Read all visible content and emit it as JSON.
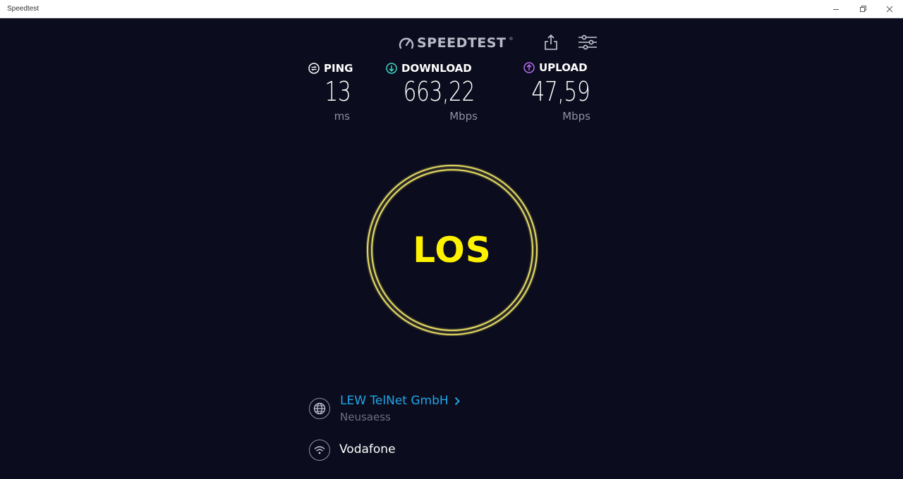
{
  "window": {
    "title": "Speedtest"
  },
  "header": {
    "logo_text": "SPEEDTEST",
    "logo_tm": "®"
  },
  "metrics": {
    "ping": {
      "label": "PING",
      "value": "13",
      "unit": "ms",
      "color": "#ffffff"
    },
    "download": {
      "label": "DOWNLOAD",
      "value": "663,22",
      "unit": "Mbps",
      "color": "#3fd6c8"
    },
    "upload": {
      "label": "UPLOAD",
      "value": "47,59",
      "unit": "Mbps",
      "color": "#b56cf0"
    }
  },
  "start_button": {
    "label": "LOS",
    "ring_color": "#e8de63",
    "text_color": "#fff200"
  },
  "server": {
    "name": "LEW TelNet GmbH",
    "location": "Neusaess"
  },
  "connection": {
    "provider": "Vodafone"
  },
  "colors": {
    "background": "#0b0c1d",
    "link": "#1fa7e8",
    "muted": "#8f92a3"
  }
}
